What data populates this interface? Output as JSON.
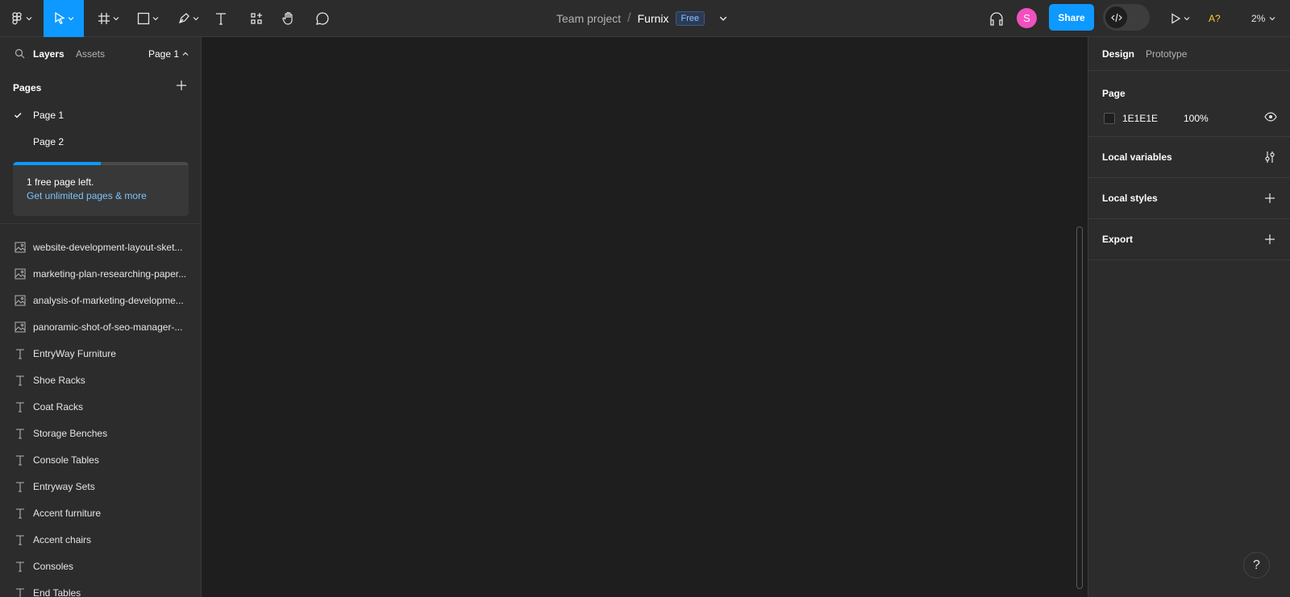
{
  "toolbar": {
    "tools": [
      "main-menu",
      "move",
      "frame",
      "shape",
      "pen",
      "text",
      "resources",
      "hand",
      "comment"
    ],
    "project": "Team project",
    "separator": "/",
    "file_name": "Furnix",
    "plan_badge": "Free",
    "avatar_initial": "S",
    "share_label": "Share",
    "a11y_label": "A?",
    "zoom": "2%"
  },
  "left": {
    "tabs": [
      "Layers",
      "Assets"
    ],
    "current_page": "Page 1",
    "pages_heading": "Pages",
    "pages": [
      {
        "label": "Page 1",
        "selected": true
      },
      {
        "label": "Page 2",
        "selected": false
      }
    ],
    "upsell": {
      "line1": "1 free page left.",
      "line2": "Get unlimited pages & more",
      "progress": 0.5
    },
    "layers": [
      {
        "type": "image",
        "name": "website-development-layout-sket..."
      },
      {
        "type": "image",
        "name": "marketing-plan-researching-paper..."
      },
      {
        "type": "image",
        "name": "analysis-of-marketing-developme..."
      },
      {
        "type": "image",
        "name": "panoramic-shot-of-seo-manager-..."
      },
      {
        "type": "text",
        "name": "EntryWay Furniture"
      },
      {
        "type": "text",
        "name": "Shoe Racks"
      },
      {
        "type": "text",
        "name": "Coat Racks"
      },
      {
        "type": "text",
        "name": "Storage Benches"
      },
      {
        "type": "text",
        "name": "Console Tables"
      },
      {
        "type": "text",
        "name": "Entryway Sets"
      },
      {
        "type": "text",
        "name": "Accent furniture"
      },
      {
        "type": "text",
        "name": "Accent chairs"
      },
      {
        "type": "text",
        "name": "Consoles"
      },
      {
        "type": "text",
        "name": "End Tables"
      }
    ]
  },
  "right": {
    "tabs": [
      "Design",
      "Prototype"
    ],
    "page_heading": "Page",
    "page_color": "1E1E1E",
    "page_opacity": "100%",
    "local_variables": "Local variables",
    "local_styles": "Local styles",
    "export": "Export"
  },
  "help_label": "?",
  "colors": {
    "accent": "#0d99ff",
    "panel": "#2c2c2c",
    "canvas": "#1e1e1e",
    "avatar": "#f24fbf",
    "warning": "#ffcd29"
  }
}
